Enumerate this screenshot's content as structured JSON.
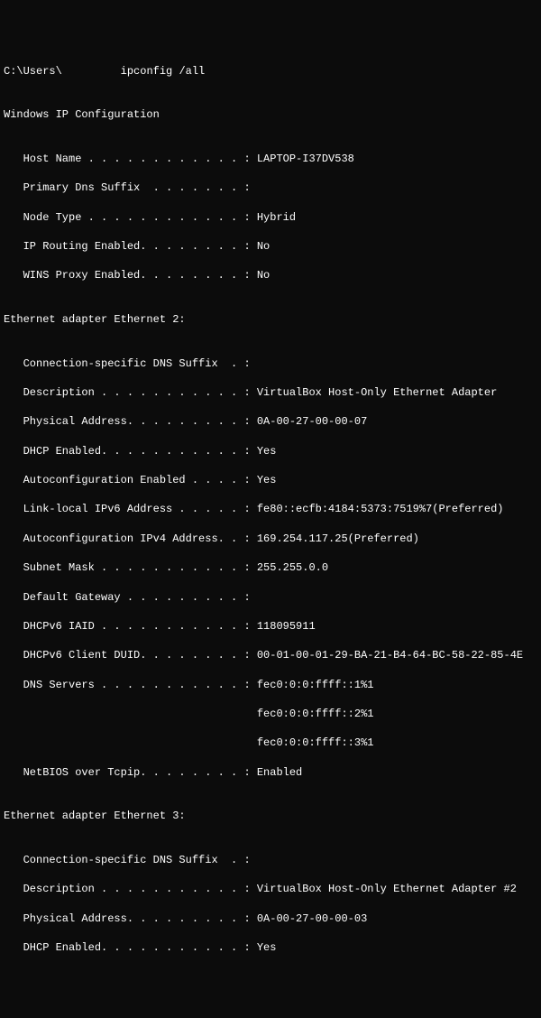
{
  "prompt": {
    "prefix": "C:\\Users\\",
    "redacted_spacer": "       ",
    "suffix": "  ipconfig /all"
  },
  "blank": "",
  "header": "Windows IP Configuration",
  "host": {
    "host_name": "   Host Name . . . . . . . . . . . . : LAPTOP-I37DV538",
    "primary_dns": "   Primary Dns Suffix  . . . . . . . :",
    "node_type": "   Node Type . . . . . . . . . . . . : Hybrid",
    "ip_routing": "   IP Routing Enabled. . . . . . . . : No",
    "wins_proxy": "   WINS Proxy Enabled. . . . . . . . : No"
  },
  "eth2": {
    "title": "Ethernet adapter Ethernet 2:",
    "conn_dns": "   Connection-specific DNS Suffix  . :",
    "description": "   Description . . . . . . . . . . . : VirtualBox Host-Only Ethernet Adapter",
    "phys_addr": "   Physical Address. . . . . . . . . : 0A-00-27-00-00-07",
    "dhcp_enabled": "   DHCP Enabled. . . . . . . . . . . : Yes",
    "autoconf": "   Autoconfiguration Enabled . . . . : Yes",
    "link_local_v6": "   Link-local IPv6 Address . . . . . : fe80::ecfb:4184:5373:7519%7(Preferred)",
    "autoconf_v4": "   Autoconfiguration IPv4 Address. . : 169.254.117.25(Preferred)",
    "subnet": "   Subnet Mask . . . . . . . . . . . : 255.255.0.0",
    "gateway": "   Default Gateway . . . . . . . . . :",
    "iaid": "   DHCPv6 IAID . . . . . . . . . . . : 118095911",
    "duid": "   DHCPv6 Client DUID. . . . . . . . : 00-01-00-01-29-BA-21-B4-64-BC-58-22-85-4E",
    "dns1": "   DNS Servers . . . . . . . . . . . : fec0:0:0:ffff::1%1",
    "dns2": "                                       fec0:0:0:ffff::2%1",
    "dns3": "                                       fec0:0:0:ffff::3%1",
    "netbios": "   NetBIOS over Tcpip. . . . . . . . : Enabled"
  },
  "eth3": {
    "title": "Ethernet adapter Ethernet 3:",
    "conn_dns": "   Connection-specific DNS Suffix  . :",
    "description": "   Description . . . . . . . . . . . : VirtualBox Host-Only Ethernet Adapter #2",
    "phys_addr": "   Physical Address. . . . . . . . . : 0A-00-27-00-00-03",
    "dhcp_enabled": "   DHCP Enabled. . . . . . . . . . . : Yes"
  }
}
